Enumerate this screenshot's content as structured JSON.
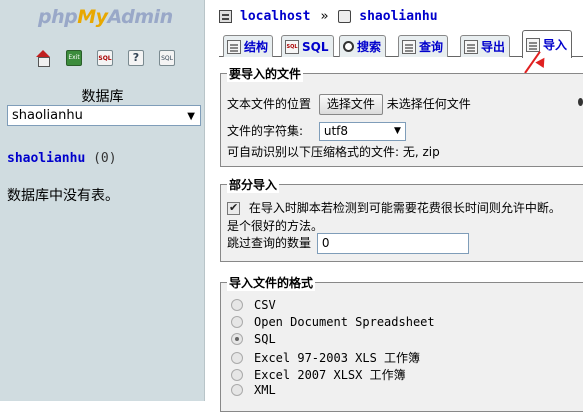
{
  "nav": {
    "logo": {
      "php": "php",
      "my": "My",
      "admin": "Admin"
    },
    "icons": [
      "home-icon",
      "exit-icon",
      "sql-query-icon",
      "help-icon",
      "sql-docs-icon"
    ],
    "db_label": "数据库",
    "db_selected": "shaolianhu",
    "db_link_name": "shaolianhu",
    "db_link_count": "(0)",
    "no_tables": "数据库中没有表。"
  },
  "breadcrumb": {
    "server": "localhost",
    "separator": "»",
    "database": "shaolianhu"
  },
  "tabs": [
    {
      "label": "结构",
      "icon": "structure-icon"
    },
    {
      "label": "SQL",
      "icon": "sql-icon"
    },
    {
      "label": "搜索",
      "icon": "search-icon"
    },
    {
      "label": "查询",
      "icon": "query-icon"
    },
    {
      "label": "导出",
      "icon": "export-icon"
    },
    {
      "label": "导入",
      "icon": "import-icon",
      "active": true
    }
  ],
  "file_section": {
    "legend": "要导入的文件",
    "location_label": "文本文件的位置",
    "choose_button": "选择文件",
    "no_file": "未选择任何文件",
    "charset_label": "文件的字符集:",
    "charset_value": "utf8",
    "compression_note": "可自动识别以下压缩格式的文件: 无, zip"
  },
  "partial_section": {
    "legend": "部分导入",
    "allow_interrupt": "在导入时脚本若检测到可能需要花费很长时间则允许中断。",
    "allow_interrupt_cont": "是个很好的方法。",
    "allow_interrupt_checked": true,
    "skip_label": "跳过查询的数量",
    "skip_value": "0"
  },
  "format_section": {
    "legend": "导入文件的格式",
    "options": [
      {
        "label": "CSV",
        "checked": false
      },
      {
        "label": "Open Document Spreadsheet",
        "checked": false
      },
      {
        "label": "SQL",
        "checked": true
      },
      {
        "label": "Excel 97-2003 XLS 工作簿",
        "checked": false
      },
      {
        "label": "Excel 2007 XLSX 工作簿",
        "checked": false
      },
      {
        "label": "XML",
        "checked": false
      }
    ]
  },
  "colors": {
    "nav_bg": "#d0dce0",
    "link": "#0000cc",
    "annotation_arrow": "#e02020"
  }
}
